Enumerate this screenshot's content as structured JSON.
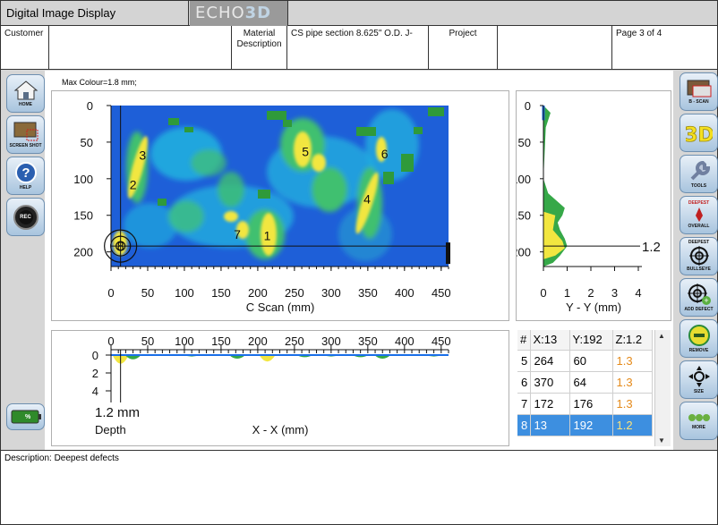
{
  "window": {
    "title": "Digital Image Display",
    "logo_text_a": "ECHO",
    "logo_text_b": "3D"
  },
  "header": {
    "customer_label": "Customer",
    "customer_value": "",
    "material_label": "Material Description",
    "material_value": "CS pipe section 8.625\" O.D. J-",
    "project_label": "Project",
    "project_value": "",
    "page": "Page 3 of 4"
  },
  "left_toolbar": [
    {
      "label": "HOME",
      "icon": "home-icon"
    },
    {
      "label": "SCREEN SHOT",
      "icon": "screenshot-icon"
    },
    {
      "label": "HELP",
      "icon": "help-icon"
    },
    {
      "label": "REC",
      "icon": "record-icon"
    }
  ],
  "battery": {
    "label": "%",
    "icon": "battery-icon"
  },
  "right_toolbar": [
    {
      "label": "B - SCAN",
      "icon": "b-scan-icon"
    },
    {
      "label": "3D",
      "icon": "3d-icon"
    },
    {
      "label": "TOOLS",
      "icon": "wrench-icon"
    },
    {
      "label": "DEEPEST",
      "label2": "OVERALL",
      "icon": "deepest-overall-icon"
    },
    {
      "label": "DEEPEST",
      "label2": "BULLSEYE",
      "icon": "bullseye-icon"
    },
    {
      "label": "ADD DEFECT",
      "icon": "add-defect-icon"
    },
    {
      "label": "REMOVE",
      "icon": "remove-icon"
    },
    {
      "label": "SIZE",
      "icon": "size-icon"
    },
    {
      "label": "MORE",
      "icon": "more-icon"
    }
  ],
  "max_colour": "Max Colour=1.8 mm;",
  "cscan": {
    "xlabel": "C Scan (mm)",
    "x_ticks": [
      "0",
      "50",
      "100",
      "150",
      "200",
      "250",
      "300",
      "350",
      "400",
      "450"
    ],
    "y_ticks": [
      "0",
      "50",
      "100",
      "150",
      "200"
    ],
    "defect_labels": [
      {
        "id": "1",
        "x": 213,
        "y": 178
      },
      {
        "id": "2",
        "x": 30,
        "y": 108
      },
      {
        "id": "3",
        "x": 43,
        "y": 68
      },
      {
        "id": "4",
        "x": 349,
        "y": 128
      },
      {
        "id": "5",
        "x": 265,
        "y": 63
      },
      {
        "id": "6",
        "x": 373,
        "y": 66
      },
      {
        "id": "7",
        "x": 172,
        "y": 176
      },
      {
        "id": "8",
        "x": 13,
        "y": 192
      }
    ],
    "cursor": {
      "x": 13,
      "y": 192
    }
  },
  "yy": {
    "xlabel": "Y - Y (mm)",
    "x_ticks": [
      "0",
      "1",
      "2",
      "3",
      "4"
    ],
    "y_ticks": [
      "0",
      "50",
      "100",
      "150",
      "200"
    ],
    "cursor_value": "1.2"
  },
  "xx": {
    "xlabel": "X - X (mm)",
    "x_ticks": [
      "0",
      "50",
      "100",
      "150",
      "200",
      "250",
      "300",
      "350",
      "400",
      "450"
    ],
    "y_ticks": [
      "0",
      "2",
      "4"
    ],
    "cursor_value": "1.2 mm",
    "depth_label": "Depth"
  },
  "table": {
    "headers": [
      "#",
      "X:13",
      "Y:192",
      "Z:1.2"
    ],
    "rows": [
      {
        "n": "5",
        "x": "264",
        "y": "60",
        "z": "1.3"
      },
      {
        "n": "6",
        "x": "370",
        "y": "64",
        "z": "1.3"
      },
      {
        "n": "7",
        "x": "172",
        "y": "176",
        "z": "1.3"
      },
      {
        "n": "8",
        "x": "13",
        "y": "192",
        "z": "1.2"
      }
    ],
    "selected_index": 3
  },
  "description": "Description: Deepest defects",
  "colors": {
    "deep_blue": "#1030b0",
    "blue": "#1a6fe8",
    "cyan": "#20c8e0",
    "green": "#2f9a3a",
    "yellow": "#f2e640",
    "selection": "#3d8fe0"
  }
}
